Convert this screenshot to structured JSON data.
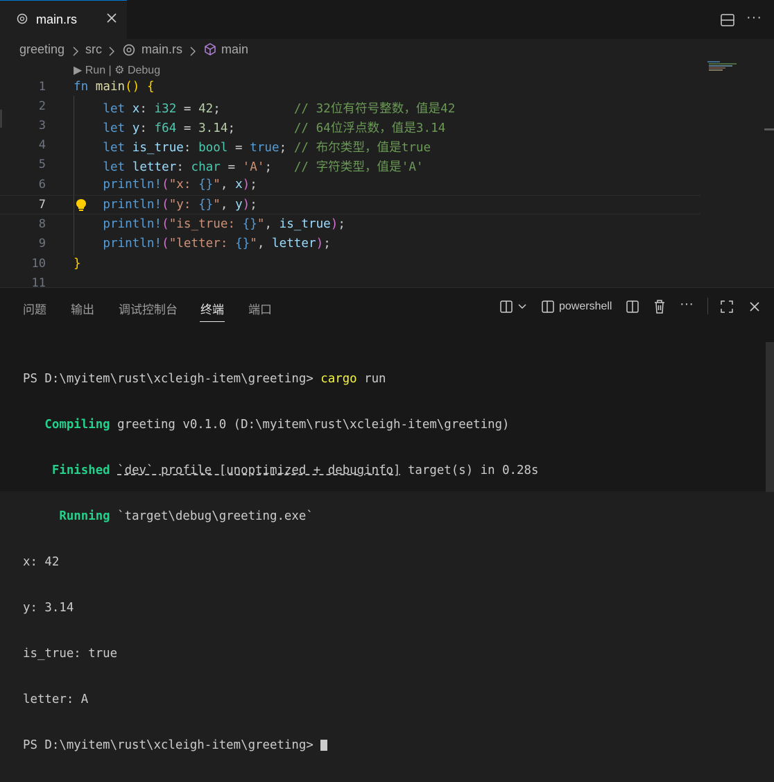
{
  "tab": {
    "label": "main.rs"
  },
  "breadcrumb": {
    "items": [
      "greeting",
      "src",
      "main.rs",
      "main"
    ]
  },
  "editor": {
    "codelens": "▶ Run | ⚙ Debug",
    "line_numbers": [
      "1",
      "2",
      "3",
      "4",
      "5",
      "6",
      "7",
      "8",
      "9",
      "10",
      "11"
    ],
    "active_line": 7
  },
  "panel": {
    "tabs": [
      "问题",
      "输出",
      "调试控制台",
      "终端",
      "端口"
    ],
    "active_tab": "终端",
    "terminal_profile": "powershell"
  },
  "terminal": {
    "prompt": "PS D:\\myitem\\rust\\xcleigh-item\\greeting> ",
    "command": "cargo",
    "command_args": " run",
    "compiling_label": "Compiling",
    "compiling_text": " greeting v0.1.0 (D:\\myitem\\rust\\xcleigh-item\\greeting)",
    "finished_label": "Finished",
    "finished_profile": "`dev` profile [unoptimized + debuginfo]",
    "finished_rest": " target(s) in 0.28s",
    "running_label": "Running",
    "running_text": " `target\\debug\\greeting.exe`",
    "output": [
      "x: 42",
      "y: 3.14",
      "is_true: true",
      "letter: A"
    ],
    "last_prompt": "PS D:\\myitem\\rust\\xcleigh-item\\greeting> "
  },
  "colors": {
    "accent": "#0078d4",
    "background": "#1f1f1f",
    "panel": "#181818"
  }
}
